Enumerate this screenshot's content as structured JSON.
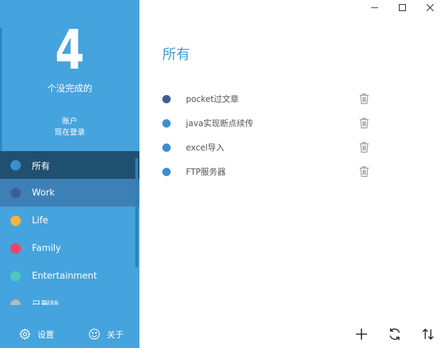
{
  "summary": {
    "incomplete_count": "4",
    "incomplete_caption": "个没完成的"
  },
  "account": {
    "title": "账户",
    "login": "现在登录"
  },
  "categories": [
    {
      "label": "所有",
      "color": "#3b8fcf",
      "state": "selected"
    },
    {
      "label": "Work",
      "color": "#3f5f94",
      "state": "hovered"
    },
    {
      "label": "Life",
      "color": "#f4b53f",
      "state": "normal"
    },
    {
      "label": "Family",
      "color": "#f0436a",
      "state": "normal"
    },
    {
      "label": "Entertainment",
      "color": "#4fc7bd",
      "state": "normal"
    },
    {
      "label": "已删除",
      "color": "#b9b9b9",
      "state": "partial"
    }
  ],
  "footer": {
    "settings_label": "设置",
    "about_label": "关于",
    "settings_icon": "gear-icon",
    "about_icon": "smiley-icon"
  },
  "main": {
    "title": "所有",
    "tasks": [
      {
        "text": "pocket过文章",
        "color": "#3f5f94"
      },
      {
        "text": "java实现断点续传",
        "color": "#3b8fcf"
      },
      {
        "text": "excel导入",
        "color": "#3b8fcf"
      },
      {
        "text": "FTP服务器",
        "color": "#3b8fcf"
      }
    ]
  },
  "window_controls": [
    "minimize-icon",
    "maximize-icon",
    "close-icon"
  ],
  "toolbar": [
    "add-icon",
    "refresh-icon",
    "sort-icon"
  ],
  "colors": {
    "sidebar": "#45a3dd",
    "selected": "#205070",
    "hovered": "#3d80b6",
    "accent": "#3f9fd8"
  }
}
